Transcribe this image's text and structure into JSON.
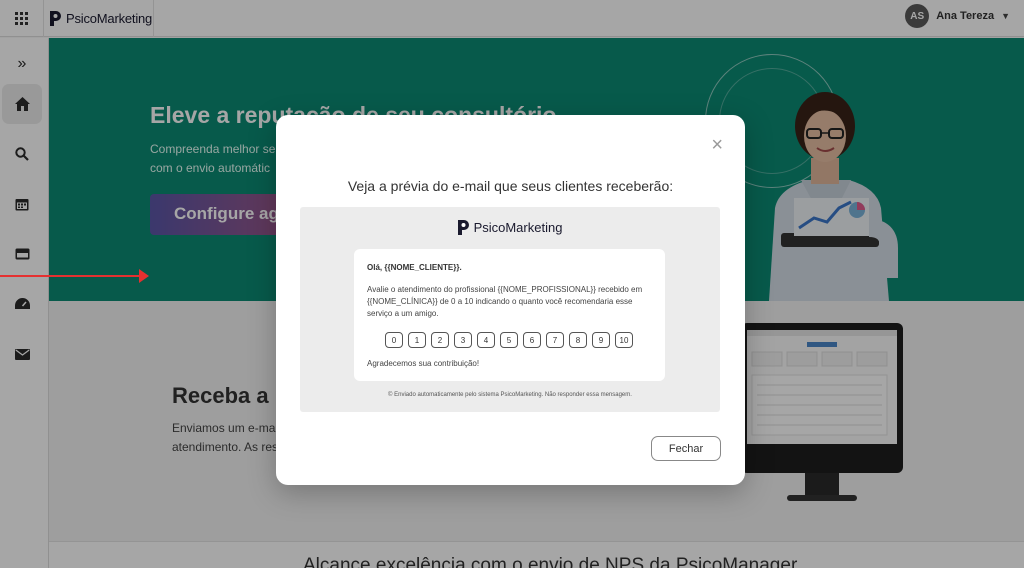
{
  "topbar": {
    "brand": "PsicoMarketing",
    "user": {
      "initials": "AS",
      "name": "Ana Tereza"
    }
  },
  "sidebar": {
    "items": [
      {
        "name": "expand",
        "glyph": "»"
      },
      {
        "name": "home",
        "glyph": "⌂"
      },
      {
        "name": "search",
        "glyph": "⌕"
      },
      {
        "name": "calendar",
        "glyph": "▦"
      },
      {
        "name": "payments",
        "glyph": "▬"
      },
      {
        "name": "dashboard",
        "glyph": "◔"
      },
      {
        "name": "email",
        "glyph": "✉"
      }
    ]
  },
  "hero": {
    "title": "Eleve a reputação de seu consultório",
    "subtitle_line1": "Compreenda melhor se",
    "subtitle_line2": "com o envio automátic",
    "cta": "Configure ag"
  },
  "section2": {
    "title": "Receba a",
    "text_line1": "Enviamos um e-mai",
    "text_line2": "atendimento. As res"
  },
  "section3": {
    "title": "Alcance excelência com o envio de NPS da PsicoManager"
  },
  "modal": {
    "title": "Veja a prévia do e-mail que seus clientes receberão:",
    "close_icon": "×",
    "preview": {
      "brand": "PsicoMarketing",
      "greeting": "Olá, {{NOME_CLIENTE}}.",
      "body": "Avalie o atendimento do profissional {{NOME_PROFISSIONAL}} recebido em {{NOME_CLÍNICA}} de 0 a 10 indicando o quanto você recomendaria esse serviço a um amigo.",
      "scale": [
        "0",
        "1",
        "2",
        "3",
        "4",
        "5",
        "6",
        "7",
        "8",
        "9",
        "10"
      ],
      "thanks": "Agradecemos sua contribuição!",
      "footer": "© Enviado automaticamente pelo sistema PsicoMarketing. Não responder essa mensagem."
    },
    "close_button": "Fechar"
  },
  "colors": {
    "hero_bg": "#0b8a73",
    "annotation_arrow": "#e53030"
  }
}
